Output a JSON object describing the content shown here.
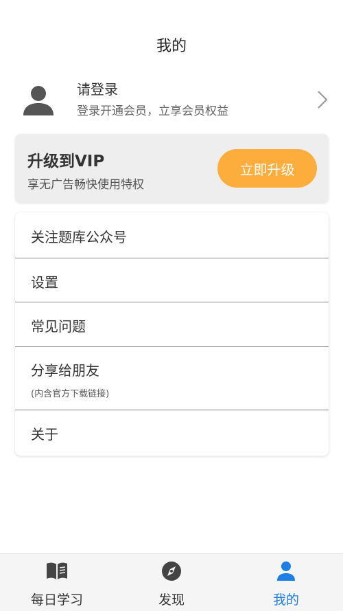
{
  "header": {
    "title": "我的"
  },
  "profile": {
    "name": "请登录",
    "subtitle": "登录开通会员，立享会员权益",
    "avatar_icon": "person-icon",
    "chevron_icon": "chevron-right-icon"
  },
  "vip": {
    "title": "升级到VIP",
    "subtitle": "享无广告畅快使用特权",
    "button_label": "立即升级",
    "button_color": "#fdad3c"
  },
  "menu": {
    "items": [
      {
        "label": "关注题库公众号"
      },
      {
        "label": "设置"
      },
      {
        "label": "常见问题"
      },
      {
        "label": "分享给朋友",
        "sublabel": "(内含官方下载链接)"
      },
      {
        "label": "关于"
      }
    ]
  },
  "tabbar": {
    "active_color": "#1d7fe6",
    "tabs": [
      {
        "label": "每日学习",
        "icon": "book-icon"
      },
      {
        "label": "发现",
        "icon": "compass-icon"
      },
      {
        "label": "我的",
        "icon": "person-icon",
        "active": true
      }
    ]
  }
}
